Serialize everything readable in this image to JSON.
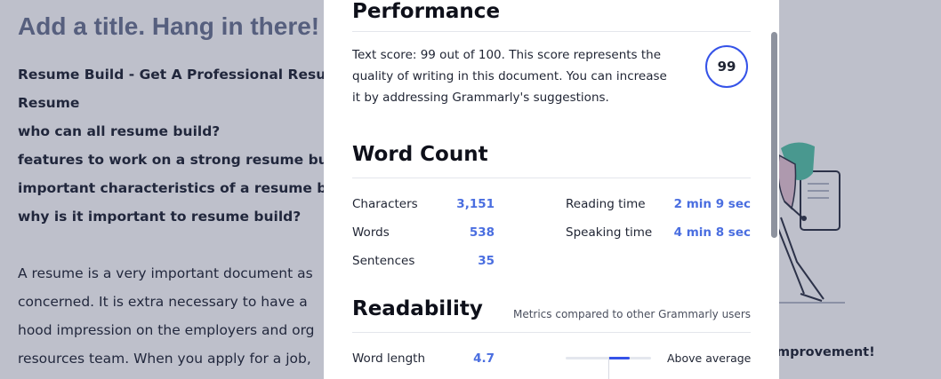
{
  "editor": {
    "title": "Add a title. Hang in there!",
    "headings": [
      "Resume Build - Get A Professional Resume",
      "Resume",
      "who can all resume build?",
      "features to work on a strong resume build",
      "important characteristics of a resume build",
      "why is it important to resume build?"
    ],
    "body_lines": [
      "A resume is a very important document as",
      "concerned. It is extra necessary to have a",
      "hood impression on the employers and org",
      "resources team. When you apply for a job,"
    ],
    "right_hint": "mprovement!"
  },
  "modal": {
    "performance": {
      "title": "Performance",
      "description": "Text score: 99 out of 100. This score represents the quality of writing in this document. You can increase it by addressing Grammarly's suggestions.",
      "score": "99",
      "score_color": "#3553e8"
    },
    "word_count": {
      "title": "Word Count",
      "characters_label": "Characters",
      "characters_value": "3,151",
      "words_label": "Words",
      "words_value": "538",
      "sentences_label": "Sentences",
      "sentences_value": "35",
      "reading_label": "Reading time",
      "reading_value": "2 min 9 sec",
      "speaking_label": "Speaking time",
      "speaking_value": "4 min 8 sec"
    },
    "readability": {
      "title": "Readability",
      "note": "Metrics compared to other Grammarly users",
      "word_length_label": "Word length",
      "word_length_value": "4.7",
      "word_length_comparison": "Above average",
      "bar_fill": {
        "start": 0.5,
        "end": 0.75
      }
    }
  },
  "colors": {
    "accent": "#4a6ee0",
    "score_ring": "#3553e8"
  }
}
